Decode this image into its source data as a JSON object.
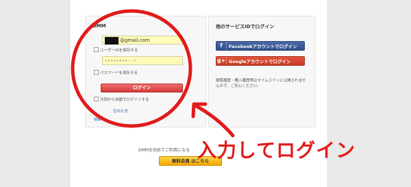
{
  "login_panel": {
    "title": "DMM",
    "email_value": "@gmail.com",
    "remember_id_label": "ユーザーIDを保存する",
    "password_placeholder": "ード",
    "remember_password_label": "パスワードを保存する",
    "login_button": "ログイン",
    "auto_login_label": "次回から自動でログインする",
    "forgot_link": "忘れた方",
    "other_link": "初期ロ"
  },
  "social_panel": {
    "title": "他のサービスIDでログイン",
    "facebook_icon": "f",
    "facebook_button": "Facebookアカウントでログイン",
    "google_icon": "g+",
    "google_button": "Googleアカウントでログイン",
    "note": "閲覧履歴・購入履歴等はタイムラインに公開されませんので、ご安心ください。"
  },
  "signup": {
    "text": "DMMを初めてご利用になる",
    "button": "無料会員 はこちら"
  },
  "annotation": {
    "callout": "入力してログイン",
    "color": "#e11b1b"
  }
}
